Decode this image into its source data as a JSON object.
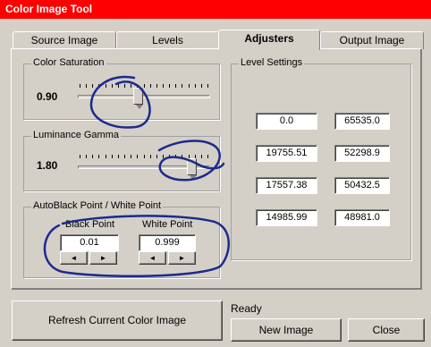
{
  "window": {
    "title": "Color Image Tool"
  },
  "tabs": [
    {
      "label": "Source Image"
    },
    {
      "label": "Levels"
    },
    {
      "label": "Adjusters"
    },
    {
      "label": "Output Image"
    }
  ],
  "color_saturation": {
    "label": "Color Saturation",
    "value": "0.90",
    "level": 0.45
  },
  "luminance_gamma": {
    "label": "Luminance Gamma",
    "value": "1.80",
    "level": 0.87
  },
  "autoblack": {
    "label": "AutoBlack Point / White Point",
    "black_label": "Black Point",
    "black_value": "0.01",
    "white_label": "White Point",
    "white_value": "0.999",
    "left_arrow": "◄",
    "right_arrow": "►"
  },
  "level_settings": {
    "label": "Level Settings",
    "rows": [
      [
        "0.0",
        "65535.0"
      ],
      [
        "19755.51",
        "52298.9"
      ],
      [
        "17557.38",
        "50432.5"
      ],
      [
        "14985.99",
        "48981.0"
      ]
    ]
  },
  "footer": {
    "refresh_label": "Refresh Current Color Image",
    "status_text": "Ready",
    "new_image_label": "New Image",
    "close_label": "Close"
  },
  "colors": {
    "title_bar": "#ff0000",
    "annotation_ink": "#1c2a8c"
  }
}
